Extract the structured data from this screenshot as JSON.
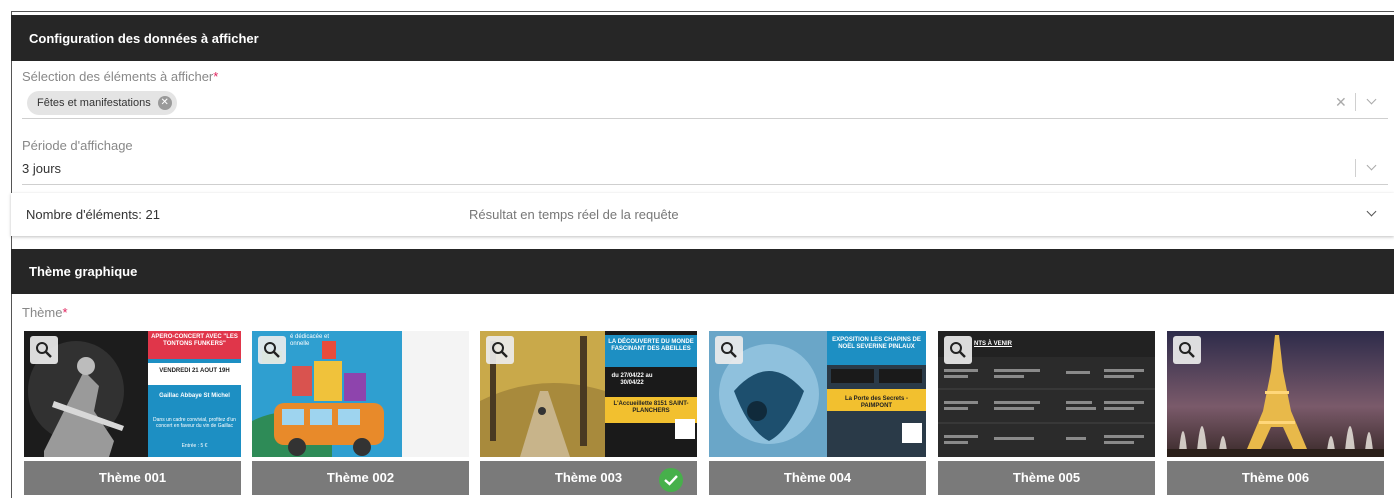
{
  "config": {
    "header": "Configuration des données à afficher",
    "selection": {
      "label": "Sélection des éléments à afficher",
      "required_mark": "*",
      "chip": "Fêtes et manifestations"
    },
    "periode": {
      "label": "Période d'affichage",
      "value": "3 jours"
    },
    "summary": {
      "count": "Nombre d'éléments: 21",
      "note": "Résultat en temps réel de la requête"
    }
  },
  "theme": {
    "header": "Thème graphique",
    "label": "Thème",
    "required_mark": "*",
    "items": [
      {
        "label": "Thème 001",
        "selected": false
      },
      {
        "label": "Thème 002",
        "selected": false
      },
      {
        "label": "Thème 003",
        "selected": true
      },
      {
        "label": "Thème 004",
        "selected": false
      },
      {
        "label": "Thème 005",
        "selected": false
      },
      {
        "label": "Thème 006",
        "selected": false
      }
    ],
    "posters": {
      "p1_title": "APERO-CONCERT AVEC \"LES TONTONS FUNKERS\"",
      "p1_date": "VENDREDI 21 AOUT 19H",
      "p1_place": "Gaillac Abbaye St Michel",
      "p1_body": "Dans un cadre convivial, profitez d'un concert en faveur du vin de Gaillac",
      "p1_price": "Entrée : 5 €",
      "p2_text": "é dédicacée et onnelle",
      "p3_title": "LA DÉCOUVERTE DU MONDE FASCINANT DES ABEILLES",
      "p3_dates": "du 27/04/22 au 30/04/22",
      "p3_place": "L'Accueillette 8151 SAINT-PLANCHERS",
      "p4_title": "EXPOSITION LES CHAPINS DE NOËL SEVERINE PINLAUX",
      "p4_place": "La Porte des Secrets - PAIMPONT",
      "p5_title": "NTS À VENIR"
    }
  },
  "colors": {
    "header_bg": "#262626",
    "required": "#e0245e",
    "selected_check": "#47b04b",
    "label_bg": "#7a7a7a"
  },
  "icons": [
    "zoom-icon",
    "clear-icon",
    "chevron-down-icon",
    "check-icon",
    "chip-remove-icon"
  ]
}
